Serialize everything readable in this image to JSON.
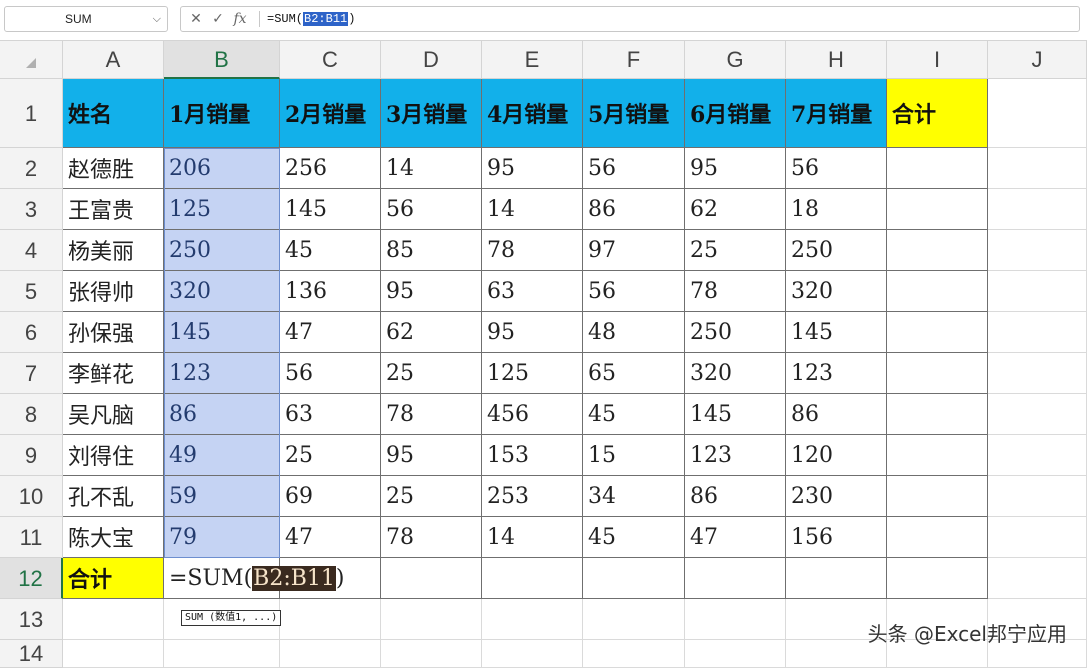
{
  "formula_bar": {
    "name_box": "SUM",
    "cancel_icon": "✕",
    "enter_icon": "✓",
    "fx_label": "fx",
    "formula_prefix": "=SUM(",
    "formula_ref": "B2:B11",
    "formula_suffix": ")"
  },
  "columns": [
    "A",
    "B",
    "C",
    "D",
    "E",
    "F",
    "G",
    "H",
    "I",
    "J"
  ],
  "rows": [
    "1",
    "2",
    "3",
    "4",
    "5",
    "6",
    "7",
    "8",
    "9",
    "10",
    "11",
    "12",
    "13",
    "14"
  ],
  "active_column": "B",
  "active_row": "12",
  "header_row": [
    "姓名",
    "1月销量",
    "2月销量",
    "3月销量",
    "4月销量",
    "5月销量",
    "6月销量",
    "7月销量",
    "合计"
  ],
  "data_rows": [
    [
      "赵德胜",
      "206",
      "256",
      "14",
      "95",
      "56",
      "95",
      "56",
      ""
    ],
    [
      "王富贵",
      "125",
      "145",
      "56",
      "14",
      "86",
      "62",
      "18",
      ""
    ],
    [
      "杨美丽",
      "250",
      "45",
      "85",
      "78",
      "97",
      "25",
      "250",
      ""
    ],
    [
      "张得帅",
      "320",
      "136",
      "95",
      "63",
      "56",
      "78",
      "320",
      ""
    ],
    [
      "孙保强",
      "145",
      "47",
      "62",
      "95",
      "48",
      "250",
      "145",
      ""
    ],
    [
      "李鲜花",
      "123",
      "56",
      "25",
      "125",
      "65",
      "320",
      "123",
      ""
    ],
    [
      "吴凡脑",
      "86",
      "63",
      "78",
      "456",
      "45",
      "145",
      "86",
      ""
    ],
    [
      "刘得住",
      "49",
      "25",
      "95",
      "153",
      "15",
      "123",
      "120",
      ""
    ],
    [
      "孔不乱",
      "59",
      "69",
      "25",
      "253",
      "34",
      "86",
      "230",
      ""
    ],
    [
      "陈大宝",
      "79",
      "47",
      "78",
      "14",
      "45",
      "47",
      "156",
      ""
    ]
  ],
  "total_row_label": "合计",
  "editing_cell": {
    "prefix": "=SUM(",
    "ref": "B2:B11",
    "suffix": ")"
  },
  "tooltip": "SUM (数值1, ...)",
  "watermark": "头条 @Excel邦宁应用",
  "colors": {
    "header_fill": "#12b0ea",
    "total_fill": "#ffff00",
    "selection_fill": "#c5d3f3",
    "active_header_accent": "#217346"
  }
}
